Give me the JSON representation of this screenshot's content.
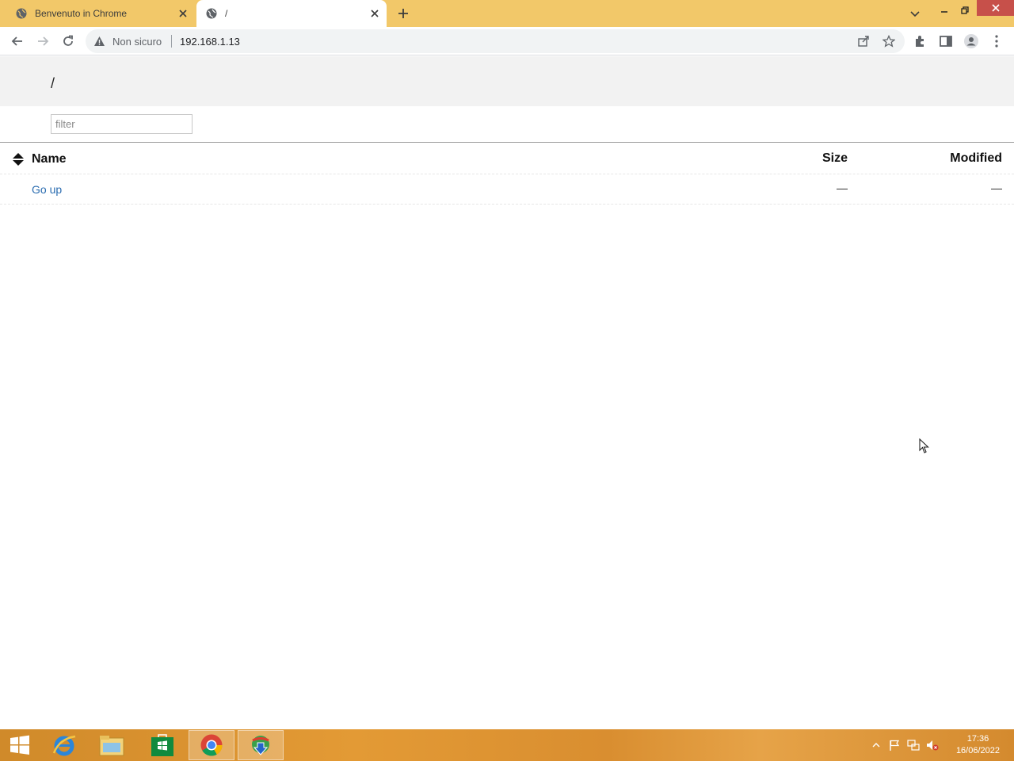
{
  "browser": {
    "tabs": [
      {
        "title": "Benvenuto in Chrome",
        "active": false
      },
      {
        "title": "/",
        "active": true
      }
    ],
    "address": {
      "security_label": "Non sicuro",
      "url": "192.168.1.13"
    }
  },
  "page": {
    "title": "/",
    "filter_placeholder": "filter",
    "columns": {
      "name": "Name",
      "size": "Size",
      "modified": "Modified"
    },
    "rows": [
      {
        "name": "Go up",
        "size": "—",
        "modified": "—"
      }
    ]
  },
  "taskbar": {
    "clock_time": "17:36",
    "clock_date": "16/06/2022"
  },
  "colors": {
    "titlebar": "#f2c869",
    "link": "#2a6cb0",
    "taskbar": "#d98e30"
  }
}
